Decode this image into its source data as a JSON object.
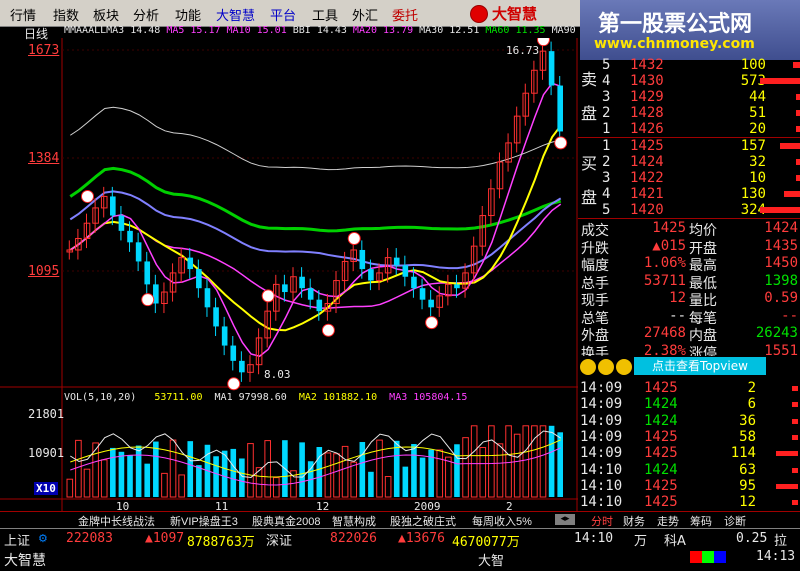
{
  "menu": [
    "行情",
    "指数",
    "板块",
    "分析",
    "功能",
    "大智慧",
    "平台",
    "工具",
    "外汇",
    "委托"
  ],
  "brand": "大智慧",
  "watermark": {
    "title": "第一股票公式网",
    "url": "www.chnmoney.com"
  },
  "chart_header": {
    "period": "日线",
    "ma_line": [
      {
        "label": "MMAAALLMA3",
        "value": "14.48",
        "color": "#e8e8e8"
      },
      {
        "label": "MA5",
        "value": "15.17",
        "color": "#ff40ff"
      },
      {
        "label": "MA10",
        "value": "15.01",
        "color": "#ff40ff"
      },
      {
        "label": "BBI",
        "value": "14.43",
        "color": "#e8e8e8"
      },
      {
        "label": "MA20",
        "value": "13.79",
        "color": "#ff40ff"
      },
      {
        "label": "MA30",
        "value": "12.51",
        "color": "#e8e8e8"
      },
      {
        "label": "MA60",
        "value": "11.35",
        "color": "#00e000"
      },
      {
        "label": "MA90",
        "value": "",
        "color": "#e8e8e8"
      }
    ]
  },
  "price_axis": [
    "1673",
    "1384",
    "1095"
  ],
  "price_annotations": {
    "high": "16.73",
    "low": "8.03"
  },
  "volume_header": {
    "title": "VOL(5,10,20)",
    "v": "53711.00",
    "ma1_label": "MA1",
    "ma1": "97998.60",
    "ma2_label": "MA2",
    "ma2": "101882.10",
    "ma3_label": "MA3",
    "ma3": "105804.15"
  },
  "volume_axis": [
    "21801",
    "10901",
    "X10"
  ],
  "time_axis": [
    "10",
    "11",
    "12",
    "2009",
    "2"
  ],
  "chart_data": {
    "type": "candlestick",
    "y_ticks": [
      "1673",
      "1384",
      "1095"
    ],
    "volume_ticks": [
      "21801",
      "10901"
    ],
    "x_ticks": [
      "10",
      "11",
      "12",
      "2009",
      "2"
    ],
    "high": 16.73,
    "low": 8.03,
    "series": [
      {
        "name": "MA5",
        "value": 15.17
      },
      {
        "name": "MA10",
        "value": 15.01
      },
      {
        "name": "BBI",
        "value": 14.43
      },
      {
        "name": "MA20",
        "value": 13.79
      },
      {
        "name": "MA30",
        "value": 12.51
      },
      {
        "name": "MA60",
        "value": 11.35
      }
    ]
  },
  "order_book": {
    "sell_label": [
      "卖",
      "盘"
    ],
    "buy_label": [
      "买",
      "盘"
    ],
    "sell": [
      {
        "lvl": "5",
        "price": "1432",
        "vol": "100"
      },
      {
        "lvl": "4",
        "price": "1430",
        "vol": "573"
      },
      {
        "lvl": "3",
        "price": "1429",
        "vol": "44"
      },
      {
        "lvl": "2",
        "price": "1428",
        "vol": "51"
      },
      {
        "lvl": "1",
        "price": "1426",
        "vol": "20"
      }
    ],
    "buy": [
      {
        "lvl": "1",
        "price": "1425",
        "vol": "157"
      },
      {
        "lvl": "2",
        "price": "1424",
        "vol": "32"
      },
      {
        "lvl": "3",
        "price": "1422",
        "vol": "10"
      },
      {
        "lvl": "4",
        "price": "1421",
        "vol": "130"
      },
      {
        "lvl": "5",
        "price": "1420",
        "vol": "324"
      }
    ]
  },
  "stats": [
    {
      "l1": "成交",
      "v1": "1425",
      "l2": "均价",
      "v2": "1424"
    },
    {
      "l1": "升跌",
      "v1": "▲015",
      "l2": "开盘",
      "v2": "1435"
    },
    {
      "l1": "幅度",
      "v1": "1.06%",
      "l2": "最高",
      "v2": "1450"
    },
    {
      "l1": "总手",
      "v1": "53711",
      "l2": "最低",
      "v2": "1398"
    },
    {
      "l1": "现手",
      "v1": "12",
      "l2": "量比",
      "v2": "0.59"
    },
    {
      "l1": "总笔",
      "v1": "--",
      "l2": "每笔",
      "v2": "--"
    },
    {
      "l1": "外盘",
      "v1": "27468",
      "l2": "内盘",
      "v2": "26243"
    },
    {
      "l1": "换手",
      "v1": "2.38%",
      "l2": "涨停",
      "v2": "1551"
    }
  ],
  "topview": "点击查看Topview",
  "ticks": [
    {
      "time": "14:09",
      "price": "1425",
      "vol": "2"
    },
    {
      "time": "14:09",
      "price": "1424",
      "vol": "6"
    },
    {
      "time": "14:09",
      "price": "1424",
      "vol": "36"
    },
    {
      "time": "14:09",
      "price": "1425",
      "vol": "58"
    },
    {
      "time": "14:09",
      "price": "1425",
      "vol": "114"
    },
    {
      "time": "14:10",
      "price": "1424",
      "vol": "63"
    },
    {
      "time": "14:10",
      "price": "1425",
      "vol": "95"
    },
    {
      "time": "14:10",
      "price": "1425",
      "vol": "12"
    }
  ],
  "bottom_tabs": [
    "金牌中长线战法",
    "新VIP操盘王3",
    "股典真金2008",
    "智慧构成",
    "股独之破庄式",
    "每周收入5%"
  ],
  "right_tabs": [
    "分时",
    "财务",
    "走势",
    "筹码",
    "诊断"
  ],
  "status": {
    "sh_label": "上证",
    "sh_val": "222083",
    "sh_chg": "▲1097",
    "sh_amt": "8788763万",
    "sz_label": "深证",
    "sz_val": "822026",
    "sz_chg": "▲13676",
    "sz_amt": "4670077万",
    "time": "14:10",
    "unit": "万",
    "sci": "科A",
    "sci_val": "0.25",
    "extra": "拉",
    "brand": "大智慧",
    "brand2": "大智",
    "time2": "14:13"
  }
}
